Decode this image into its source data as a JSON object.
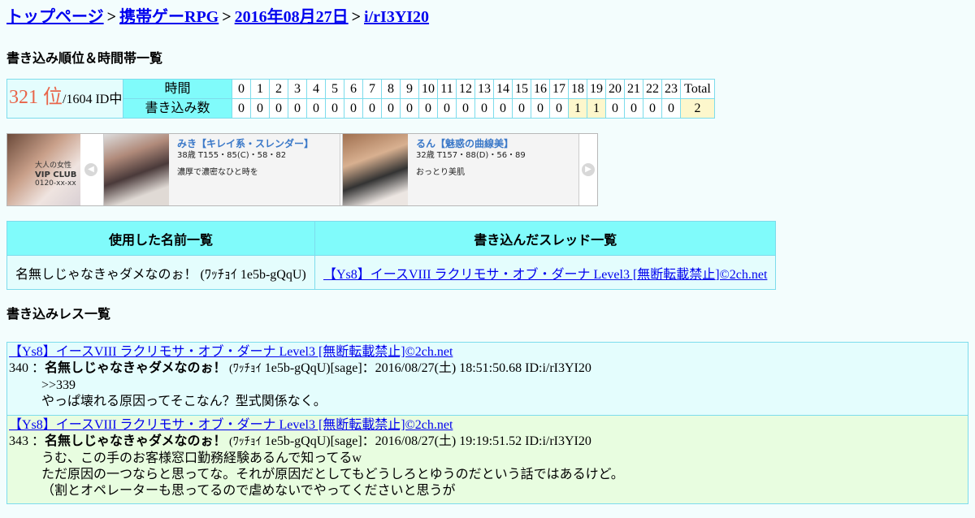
{
  "breadcrumb": {
    "items": [
      "トップページ",
      "携帯ゲーRPG",
      "2016年08月27日",
      "i/rI3YI20"
    ],
    "separator": ">"
  },
  "rank_section": {
    "title": "書き込み順位＆時間帯一覧",
    "rank": "321 位",
    "rank_suffix": "/1604 ID中",
    "row1_label": "時間",
    "row2_label": "書き込み数",
    "hours": [
      "0",
      "1",
      "2",
      "3",
      "4",
      "5",
      "6",
      "7",
      "8",
      "9",
      "10",
      "11",
      "12",
      "13",
      "14",
      "15",
      "16",
      "17",
      "18",
      "19",
      "20",
      "21",
      "22",
      "23"
    ],
    "counts": [
      "0",
      "0",
      "0",
      "0",
      "0",
      "0",
      "0",
      "0",
      "0",
      "0",
      "0",
      "0",
      "0",
      "0",
      "0",
      "0",
      "0",
      "0",
      "1",
      "1",
      "0",
      "0",
      "0",
      "0"
    ],
    "total_label": "Total",
    "total": "2"
  },
  "banner": {
    "logo_text": [
      "大人の女性",
      "VIP CLUB",
      "0120-xx-xx"
    ],
    "cards": [
      {
        "name": "みき【キレイ系・スレンダー】",
        "spec": "38歳 T155・85(C)・58・82",
        "desc": "濃厚で濃密なひと時を"
      },
      {
        "name": "るん【魅惑の曲線美】",
        "spec": "32歳 T157・88(D)・56・89",
        "desc": "おっとり美肌"
      }
    ],
    "prev_icon": "chevron-left-icon",
    "next_icon": "chevron-right-icon"
  },
  "names_section": {
    "col1_header": "使用した名前一覧",
    "col2_header": "書き込んだスレッド一覧",
    "name": "名無しじゃなきゃダメなのぉ！ (ﾜｯﾁｮｲ 1e5b-gQqU)",
    "thread": "【Ys8】イースVIII ラクリモサ・オブ・ダーナ Level3 [無断転載禁止]©2ch.net"
  },
  "posts_section": {
    "title": "書き込みレス一覧",
    "posts": [
      {
        "thread": "【Ys8】イースVIII ラクリモサ・オブ・ダーナ Level3 [無断転載禁止]©2ch.net",
        "num": "340 ：",
        "name": "名無しじゃなきゃダメなのぉ！",
        "trip": " (ﾜｯﾁｮｲ",
        "meta": " 1e5b-gQqU)[sage]：2016/08/27(土) 18:51:50.68 ID:i/rI3YI20",
        "lines": [
          ">>339",
          "やっぱ壊れる原因ってそこなん？型式関係なく。"
        ]
      },
      {
        "thread": "【Ys8】イースVIII ラクリモサ・オブ・ダーナ Level3 [無断転載禁止]©2ch.net",
        "num": "343 ：",
        "name": "名無しじゃなきゃダメなのぉ！",
        "trip": " (ﾜｯﾁｮｲ",
        "meta": " 1e5b-gQqU)[sage]：2016/08/27(土) 19:19:51.52 ID:i/rI3YI20",
        "lines": [
          "うむ、この手のお客様窓口勤務経験あるんで知ってるw",
          "ただ原因の一つならと思ってな。それが原因だとしてもどうしろとゆうのだという話ではあるけど。",
          "（割とオペレーターも思ってるので虐めないでやってくださいと思うが"
        ]
      }
    ]
  }
}
